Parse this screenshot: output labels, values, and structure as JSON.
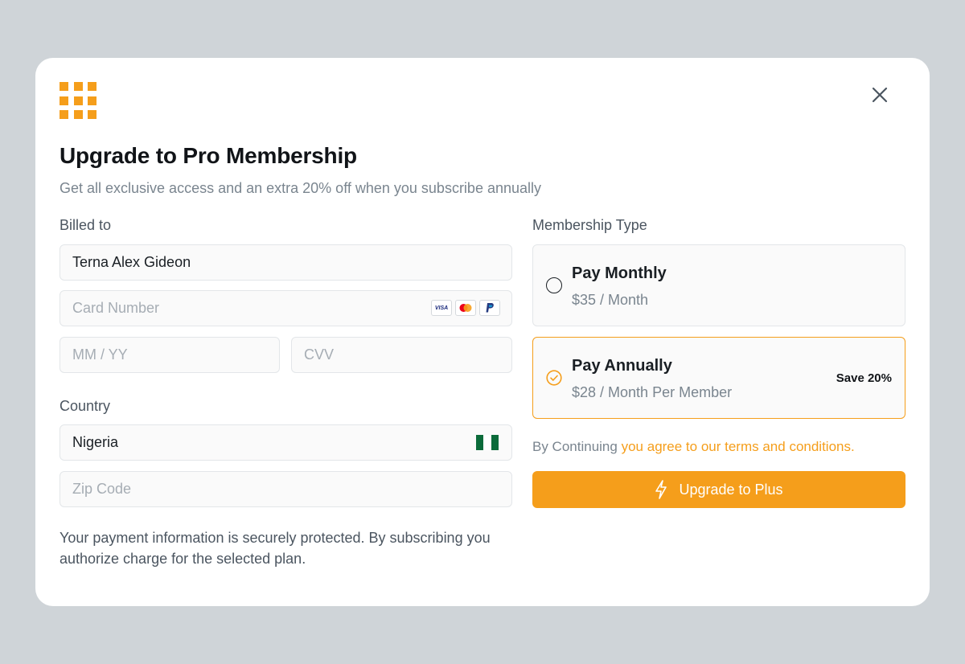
{
  "header": {
    "title": "Upgrade to Pro Membership",
    "subtitle": "Get all exclusive access and an extra 20% off when you subscribe annually",
    "logo_icon": "grid-logo-icon",
    "close_icon": "close-icon"
  },
  "billing": {
    "billed_to_label": "Billed to",
    "name_value": "Terna Alex Gideon",
    "card_number_placeholder": "Card Number",
    "card_icons": [
      "visa-icon",
      "mastercard-icon",
      "paypal-icon"
    ],
    "visa_text": "VISA",
    "expiry_placeholder": "MM / YY",
    "cvv_placeholder": "CVV",
    "country_label": "Country",
    "country_value": "Nigeria",
    "zip_placeholder": "Zip Code",
    "note": "Your payment information is securely protected. By subscribing you authorize charge for the selected plan."
  },
  "membership": {
    "label": "Membership Type",
    "plans": [
      {
        "name": "Pay Monthly",
        "price": "$35 / Month",
        "selected": false,
        "badge": ""
      },
      {
        "name": "Pay Annually",
        "price": "$28 / Month Per Member",
        "selected": true,
        "badge": "Save 20%"
      }
    ],
    "terms_prefix": "By Continuing",
    "terms_link": "agree to our terms and conditions.",
    "terms_link_lead": "you",
    "cta_label": "Upgrade to Plus"
  },
  "colors": {
    "accent": "#f59e1b",
    "backdrop": "#cfd4d8",
    "text_primary": "#111418",
    "text_muted": "#7a858f",
    "flag_green": "#0b6b3a"
  }
}
